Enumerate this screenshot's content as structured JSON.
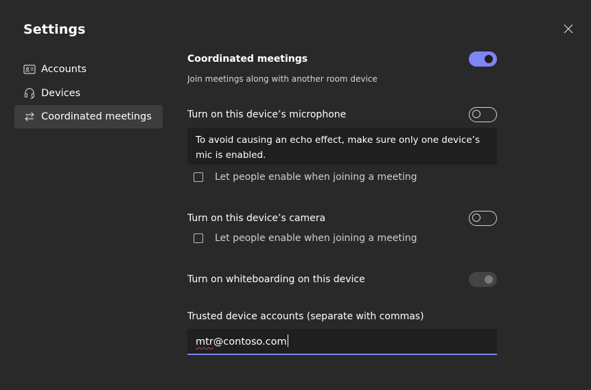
{
  "dialog": {
    "title": "Settings",
    "close_icon": "close-icon"
  },
  "sidebar": {
    "items": [
      {
        "label": "Accounts",
        "icon": "contact-card-icon",
        "active": false
      },
      {
        "label": "Devices",
        "icon": "headset-icon",
        "active": false
      },
      {
        "label": "Coordinated meetings",
        "icon": "arrows-swap-icon",
        "active": true
      }
    ]
  },
  "coordinated": {
    "title": "Coordinated meetings",
    "description": "Join meetings along with another room device",
    "enabled": true
  },
  "microphone": {
    "label": "Turn on this device’s microphone",
    "enabled": false,
    "notice": "To avoid causing an echo effect, make sure only one device’s mic is enabled.",
    "let_people_label": "Let people enable when joining a meeting",
    "let_people_checked": false
  },
  "camera": {
    "label": "Turn on this device’s camera",
    "enabled": false,
    "let_people_label": "Let people enable when joining a meeting",
    "let_people_checked": false
  },
  "whiteboard": {
    "label": "Turn on whiteboarding on this device",
    "enabled": true,
    "disabled": true
  },
  "trusted_accounts": {
    "label": "Trusted device accounts (separate with commas)",
    "value_part1": "mtr",
    "value_part2": "@contoso.com"
  },
  "colors": {
    "background": "#292929",
    "accent": "#7f85f5",
    "field_background": "#1f1f1f",
    "active_nav": "#3d3d3d"
  }
}
